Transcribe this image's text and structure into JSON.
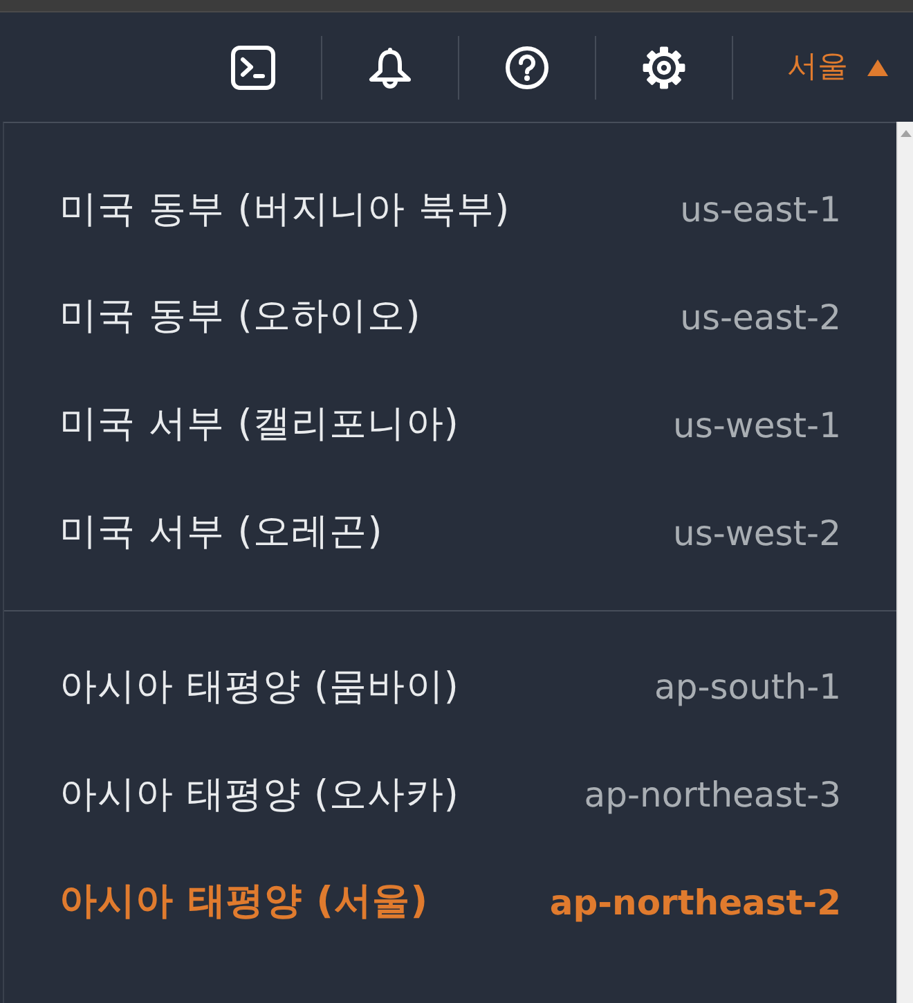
{
  "toolbar": {
    "region_selector": {
      "label": "서울",
      "expanded": true
    }
  },
  "region_menu": {
    "groups": [
      {
        "items": [
          {
            "name": "미국 동부 (버지니아 북부)",
            "code": "us-east-1",
            "selected": false
          },
          {
            "name": "미국 동부 (오하이오)",
            "code": "us-east-2",
            "selected": false
          },
          {
            "name": "미국 서부 (캘리포니아)",
            "code": "us-west-1",
            "selected": false
          },
          {
            "name": "미국 서부 (오레곤)",
            "code": "us-west-2",
            "selected": false
          }
        ]
      },
      {
        "items": [
          {
            "name": "아시아 태평양 (뭄바이)",
            "code": "ap-south-1",
            "selected": false
          },
          {
            "name": "아시아 태평양 (오사카)",
            "code": "ap-northeast-3",
            "selected": false
          },
          {
            "name": "아시아 태평양 (서울)",
            "code": "ap-northeast-2",
            "selected": true
          }
        ]
      }
    ]
  }
}
